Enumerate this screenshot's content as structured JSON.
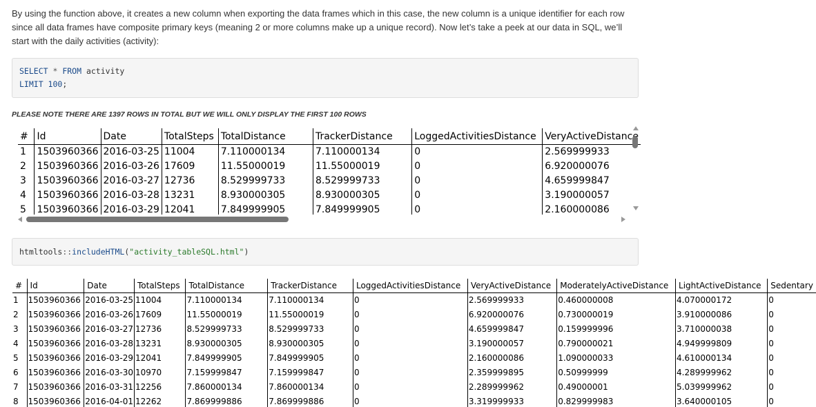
{
  "intro_text": "By using the function above, it creates a new column when exporting the data frames which in this case, the new column is a unique identifier for each row since all data frames have composite primary keys (meaning 2 or more columns make up a unique record). Now let’s take a peek at our data in SQL, we’ll start with the daily activities (activity):",
  "sql_code": {
    "line1_kw1": "SELECT",
    "line1_star": " * ",
    "line1_kw2": "FROM",
    "line1_rest": " activity",
    "line2_kw": "LIMIT",
    "line2_num": " 100",
    "line2_end": ";"
  },
  "note": "PLEASE NOTE THERE ARE 1397 ROWS IN TOTAL BUT WE WILL ONLY DISPLAY THE FIRST 100 ROWS",
  "sql_table": {
    "columns": [
      "#",
      "Id",
      "Date",
      "TotalSteps",
      "TotalDistance",
      "TrackerDistance",
      "LoggedActivitiesDistance",
      "VeryActiveDistance"
    ],
    "rows": [
      [
        "1",
        "1503960366",
        "2016-03-25",
        "11004",
        "7.110000134",
        "7.110000134",
        "0",
        "2.569999933"
      ],
      [
        "2",
        "1503960366",
        "2016-03-26",
        "17609",
        "11.55000019",
        "11.55000019",
        "0",
        "6.920000076"
      ],
      [
        "3",
        "1503960366",
        "2016-03-27",
        "12736",
        "8.529999733",
        "8.529999733",
        "0",
        "4.659999847"
      ],
      [
        "4",
        "1503960366",
        "2016-03-28",
        "13231",
        "8.930000305",
        "8.930000305",
        "0",
        "3.190000057"
      ],
      [
        "5",
        "1503960366",
        "2016-03-29",
        "12041",
        "7.849999905",
        "7.849999905",
        "0",
        "2.160000086"
      ]
    ]
  },
  "r_code": {
    "pkg": "htmltools",
    "sep": "::",
    "fn": "includeHTML",
    "open": "(",
    "arg": "\"activity_tableSQL.html\"",
    "close": ")"
  },
  "big_table": {
    "columns": [
      "#",
      "Id",
      "Date",
      "TotalSteps",
      "TotalDistance",
      "TrackerDistance",
      "LoggedActivitiesDistance",
      "VeryActiveDistance",
      "ModeratelyActiveDistance",
      "LightActiveDistance",
      "Sedentary"
    ],
    "rows": [
      [
        "1",
        "1503960366",
        "2016-03-25",
        "11004",
        "7.110000134",
        "7.110000134",
        "0",
        "2.569999933",
        "0.460000008",
        "4.070000172",
        "0"
      ],
      [
        "2",
        "1503960366",
        "2016-03-26",
        "17609",
        "11.55000019",
        "11.55000019",
        "0",
        "6.920000076",
        "0.730000019",
        "3.910000086",
        "0"
      ],
      [
        "3",
        "1503960366",
        "2016-03-27",
        "12736",
        "8.529999733",
        "8.529999733",
        "0",
        "4.659999847",
        "0.159999996",
        "3.710000038",
        "0"
      ],
      [
        "4",
        "1503960366",
        "2016-03-28",
        "13231",
        "8.930000305",
        "8.930000305",
        "0",
        "3.190000057",
        "0.790000021",
        "4.949999809",
        "0"
      ],
      [
        "5",
        "1503960366",
        "2016-03-29",
        "12041",
        "7.849999905",
        "7.849999905",
        "0",
        "2.160000086",
        "1.090000033",
        "4.610000134",
        "0"
      ],
      [
        "6",
        "1503960366",
        "2016-03-30",
        "10970",
        "7.159999847",
        "7.159999847",
        "0",
        "2.359999895",
        "0.50999999",
        "4.289999962",
        "0"
      ],
      [
        "7",
        "1503960366",
        "2016-03-31",
        "12256",
        "7.860000134",
        "7.860000134",
        "0",
        "2.289999962",
        "0.49000001",
        "5.039999962",
        "0"
      ],
      [
        "8",
        "1503960366",
        "2016-04-01",
        "12262",
        "7.869999886",
        "7.869999886",
        "0",
        "3.319999933",
        "0.829999983",
        "3.640000105",
        "0"
      ]
    ]
  }
}
